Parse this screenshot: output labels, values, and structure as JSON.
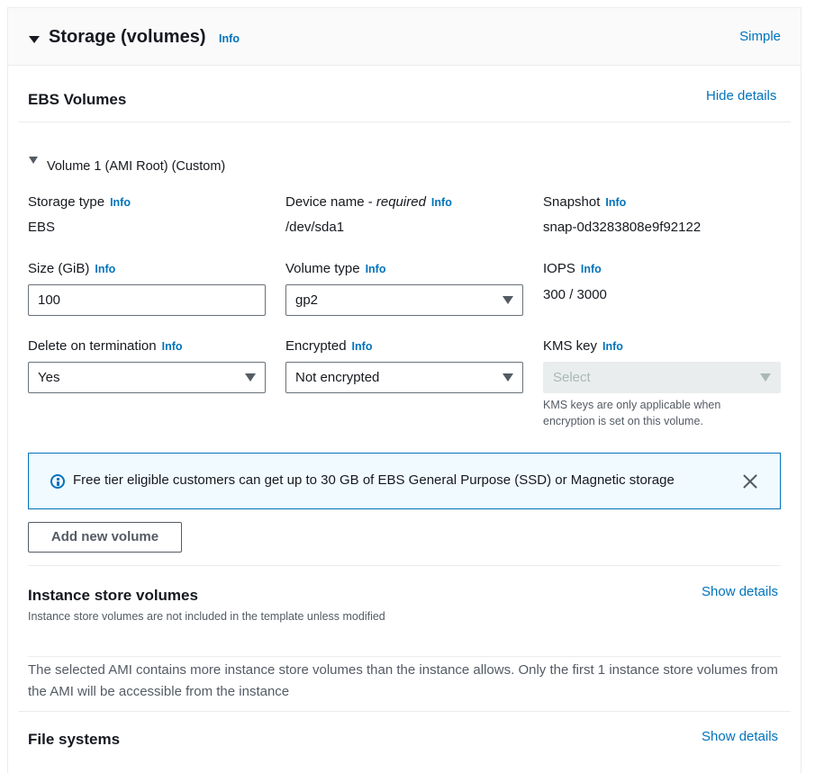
{
  "header": {
    "title": "Storage (volumes)",
    "info": "Info",
    "mode_link": "Simple"
  },
  "ebs": {
    "title": "EBS Volumes",
    "toggle_link": "Hide details",
    "volume_title": "Volume 1 (AMI Root) (Custom)",
    "storage_type": {
      "label": "Storage type",
      "info": "Info",
      "value": "EBS"
    },
    "device_name": {
      "label": "Device name - ",
      "required": "required",
      "info": "Info",
      "value": "/dev/sda1"
    },
    "snapshot": {
      "label": "Snapshot",
      "info": "Info",
      "value": "snap-0d3283808e9f92122"
    },
    "size": {
      "label": "Size (GiB)",
      "info": "Info",
      "value": "100"
    },
    "volume_type": {
      "label": "Volume type",
      "info": "Info",
      "value": "gp2"
    },
    "iops": {
      "label": "IOPS",
      "info": "Info",
      "value": "300 / 3000"
    },
    "delete_on_termination": {
      "label": "Delete on termination",
      "info": "Info",
      "value": "Yes"
    },
    "encrypted": {
      "label": "Encrypted",
      "info": "Info",
      "value": "Not encrypted"
    },
    "kms_key": {
      "label": "KMS key",
      "info": "Info",
      "placeholder": "Select",
      "hint_line1": "KMS keys are only applicable when",
      "hint_line2": "encryption is set on this volume."
    },
    "alert_text": "Free tier eligible customers can get up to 30 GB of EBS General Purpose (SSD) or Magnetic storage",
    "add_button": "Add new volume"
  },
  "instance_store": {
    "title": "Instance store volumes",
    "subtitle": "Instance store volumes are not included in the template unless modified",
    "toggle_link": "Show details",
    "message": "The selected AMI contains more instance store volumes than the instance allows. Only the first 1 instance store volumes from the AMI will be accessible from the instance"
  },
  "file_systems": {
    "title": "File systems",
    "toggle_link": "Show details"
  },
  "colors": {
    "link": "#0073bb",
    "text": "#16191f",
    "secondary_text": "#545b64",
    "alert_bg": "#f1faff",
    "alert_border": "#0073bb"
  },
  "icons": {
    "section_toggle": "caret-down-icon",
    "volume_toggle": "caret-down-icon",
    "alert": "info-circle-icon",
    "dismiss": "close-icon",
    "dropdown": "dropdown-triangle-icon"
  }
}
